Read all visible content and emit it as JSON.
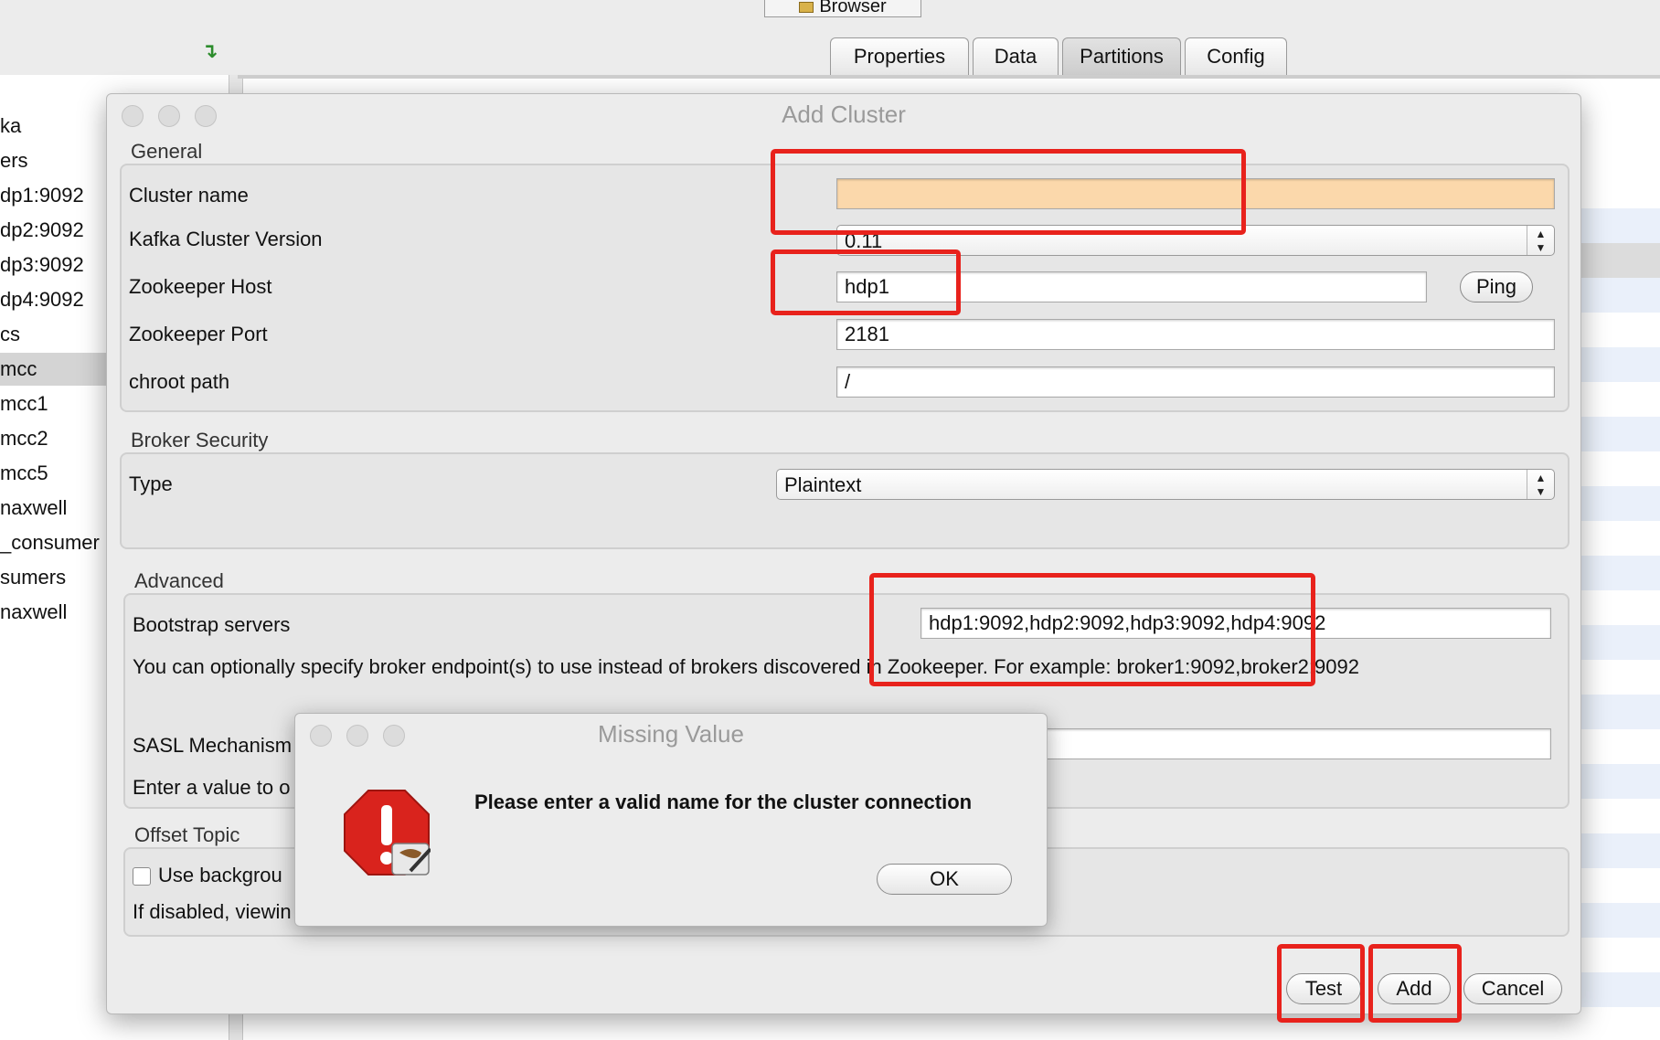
{
  "app": {
    "browser_tab": "Browser",
    "tabs": [
      "Properties",
      "Data",
      "Partitions",
      "Config"
    ],
    "active_tab": "Partitions",
    "tree_items": [
      "ka",
      "ers",
      "dp1:9092",
      "dp2:9092",
      "dp3:9092",
      "dp4:9092",
      "cs",
      "mcc",
      "mcc1",
      "mcc2",
      "mcc5",
      "naxwell",
      "_consumer",
      "sumers",
      "naxwell"
    ],
    "selected_tree_item": "mcc"
  },
  "dialog": {
    "title": "Add Cluster",
    "general": {
      "label": "General",
      "cluster_name_label": "Cluster name",
      "cluster_name_value": "",
      "kafka_version_label": "Kafka Cluster Version",
      "kafka_version_value": "0.11",
      "zk_host_label": "Zookeeper Host",
      "zk_host_value": "hdp1",
      "ping_label": "Ping",
      "zk_port_label": "Zookeeper Port",
      "zk_port_value": "2181",
      "chroot_label": "chroot path",
      "chroot_value": "/"
    },
    "broker_security": {
      "label": "Broker Security",
      "type_label": "Type",
      "type_value": "Plaintext"
    },
    "advanced": {
      "label": "Advanced",
      "bootstrap_label": "Bootstrap servers",
      "bootstrap_value": "hdp1:9092,hdp2:9092,hdp3:9092,hdp4:9092",
      "bootstrap_help": "You can optionally specify broker endpoint(s) to use instead of brokers discovered in Zookeeper. For example: broker1:9092,broker2:9092",
      "sasl_label": "SASL Mechanism",
      "sasl_help": "Enter a value to o"
    },
    "offset_topic": {
      "label": "Offset Topic",
      "checkbox_label": "Use backgrou",
      "help": "If disabled, viewin"
    },
    "buttons": {
      "test": "Test",
      "add": "Add",
      "cancel": "Cancel"
    }
  },
  "popup": {
    "title": "Missing Value",
    "message": "Please enter a valid name for the cluster connection",
    "ok": "OK"
  },
  "colors": {
    "highlight_red": "#e8221c",
    "error_field": "#fbd8ab",
    "warning_red": "#d9231d"
  }
}
